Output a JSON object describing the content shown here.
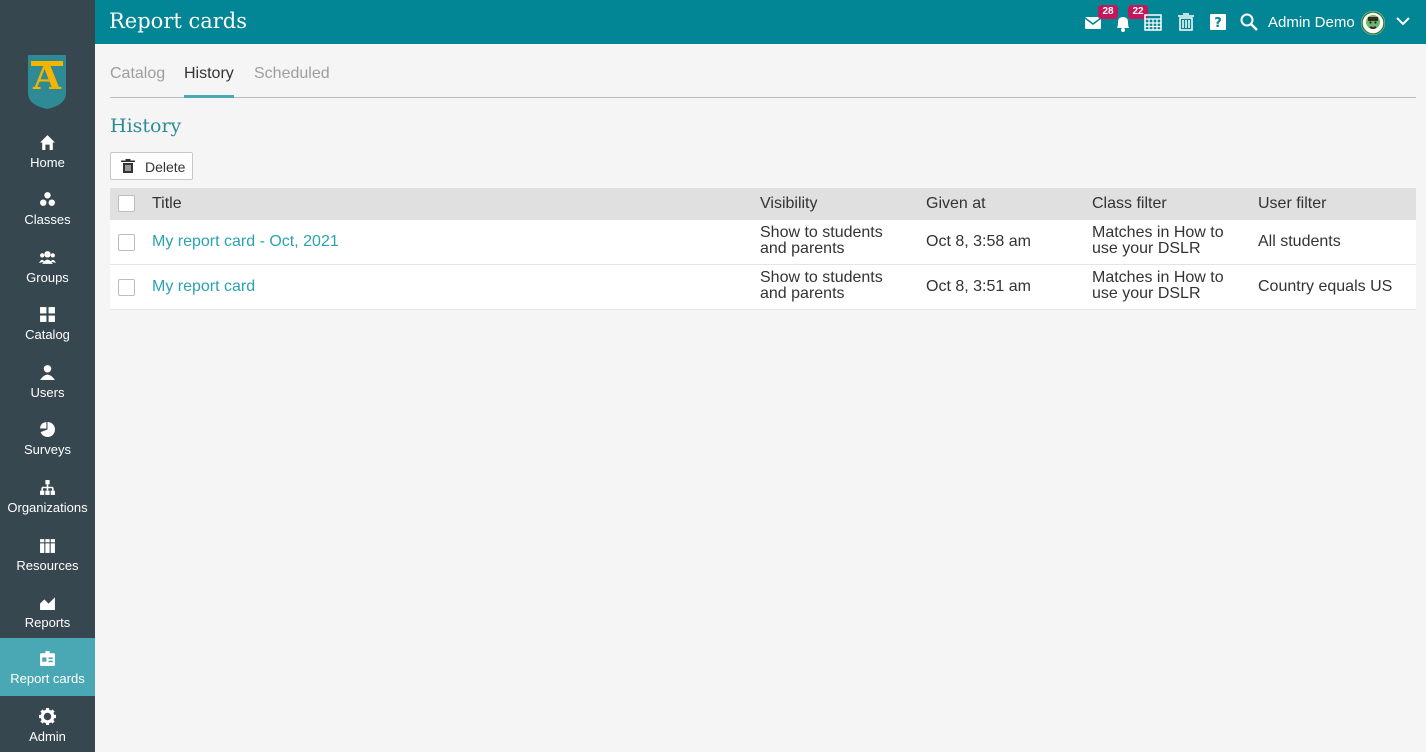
{
  "app": {
    "title": "Report cards",
    "user_name": "Admin Demo",
    "badges": {
      "messages": "28",
      "notifications": "22"
    }
  },
  "sidebar": {
    "items": [
      {
        "label": "Home",
        "icon": "home-icon"
      },
      {
        "label": "Classes",
        "icon": "classes-icon"
      },
      {
        "label": "Groups",
        "icon": "groups-icon"
      },
      {
        "label": "Catalog",
        "icon": "catalog-icon"
      },
      {
        "label": "Users",
        "icon": "user-icon"
      },
      {
        "label": "Surveys",
        "icon": "surveys-icon"
      },
      {
        "label": "Organizations",
        "icon": "organizations-icon"
      },
      {
        "label": "Resources",
        "icon": "resources-icon"
      },
      {
        "label": "Reports",
        "icon": "reports-icon"
      },
      {
        "label": "Report cards",
        "icon": "report-cards-icon",
        "active": true
      },
      {
        "label": "Admin",
        "icon": "gear-icon"
      }
    ]
  },
  "tabs": [
    {
      "label": "Catalog",
      "active": false
    },
    {
      "label": "History",
      "active": true
    },
    {
      "label": "Scheduled",
      "active": false
    }
  ],
  "section": {
    "title": "History"
  },
  "toolbar": {
    "delete_label": "Delete"
  },
  "table": {
    "columns": [
      "Title",
      "Visibility",
      "Given at",
      "Class filter",
      "User filter"
    ],
    "rows": [
      {
        "title": "My report card - Oct, 2021",
        "visibility_line1": "Show to students",
        "visibility_line2": "and parents",
        "given_at": "Oct 8, 3:58 am",
        "class_filter_line1": "Matches in How to",
        "class_filter_line2": "use your DSLR",
        "user_filter": "All students"
      },
      {
        "title": "My report card",
        "visibility_line1": "Show to students",
        "visibility_line2": "and parents",
        "given_at": "Oct 8, 3:51 am",
        "class_filter_line1": "Matches in How to",
        "class_filter_line2": "use your DSLR",
        "user_filter": "Country equals US"
      }
    ]
  },
  "colors": {
    "topbar": "#028595",
    "sidebar": "#37474f",
    "accent": "#4aa8b4",
    "link": "#2aa3b0",
    "badge": "#c2185b"
  }
}
